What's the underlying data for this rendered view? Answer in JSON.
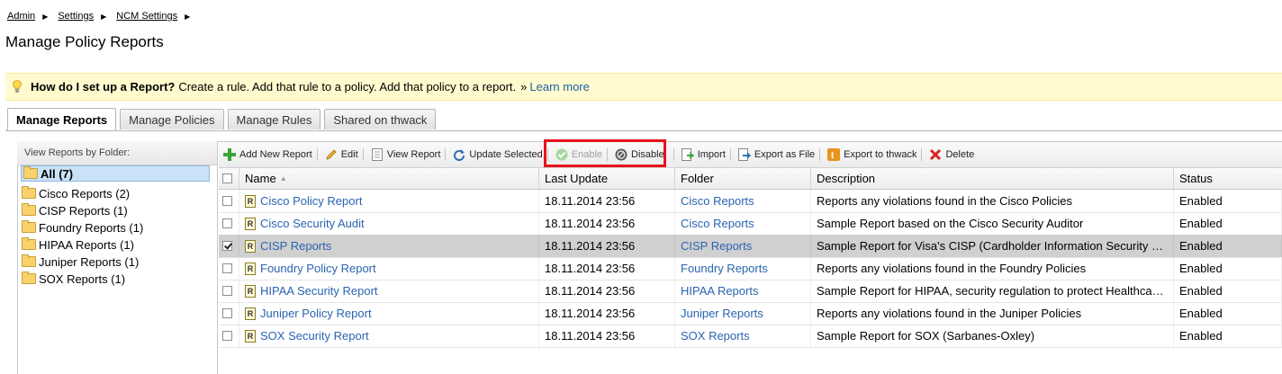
{
  "breadcrumb": [
    "Admin",
    "Settings",
    "NCM Settings"
  ],
  "page_title": "Manage Policy Reports",
  "hint": {
    "question": "How do I set up a Report?",
    "text": "Create a rule. Add that rule to a policy. Add that policy to a report.",
    "link_prefix": "»",
    "link": "Learn more"
  },
  "tabs": [
    "Manage Reports",
    "Manage Policies",
    "Manage Rules",
    "Shared on thwack"
  ],
  "folder_panel": {
    "header": "View Reports by Folder:",
    "items": [
      "All (7)",
      "Cisco Reports (2)",
      "CISP Reports (1)",
      "Foundry Reports (1)",
      "HIPAA Reports (1)",
      "Juniper Reports (1)",
      "SOX Reports (1)"
    ]
  },
  "toolbar": {
    "add": "Add New Report",
    "edit": "Edit",
    "view": "View Report",
    "update": "Update Selected",
    "enable": "Enable",
    "disable": "Disable",
    "import": "Import",
    "export_file": "Export as File",
    "export_thwack": "Export to thwack",
    "delete": "Delete"
  },
  "grid": {
    "columns": [
      "Name",
      "Last Update",
      "Folder",
      "Description",
      "Status"
    ],
    "sort_indicator": "▲",
    "rows": [
      {
        "name": "Cisco Policy Report",
        "date": "18.11.2014 23:56",
        "folder": "Cisco Reports",
        "desc": "Reports any violations found in the Cisco Policies",
        "status": "Enabled"
      },
      {
        "name": "Cisco Security Audit",
        "date": "18.11.2014 23:56",
        "folder": "Cisco Reports",
        "desc": "Sample Report based on the Cisco Security Auditor",
        "status": "Enabled"
      },
      {
        "name": "CISP Reports",
        "date": "18.11.2014 23:56",
        "folder": "CISP Reports",
        "desc": "Sample Report for Visa's CISP (Cardholder Information Security …",
        "status": "Enabled"
      },
      {
        "name": "Foundry Policy Report",
        "date": "18.11.2014 23:56",
        "folder": "Foundry Reports",
        "desc": "Reports any violations found in the Foundry Policies",
        "status": "Enabled"
      },
      {
        "name": "HIPAA Security Report",
        "date": "18.11.2014 23:56",
        "folder": "HIPAA Reports",
        "desc": "Sample Report for HIPAA, security regulation to protect Healthca…",
        "status": "Enabled"
      },
      {
        "name": "Juniper Policy Report",
        "date": "18.11.2014 23:56",
        "folder": "Juniper Reports",
        "desc": "Reports any violations found in the Juniper Policies",
        "status": "Enabled"
      },
      {
        "name": "SOX Security Report",
        "date": "18.11.2014 23:56",
        "folder": "SOX Reports",
        "desc": "Sample Report for SOX (Sarbanes-Oxley)",
        "status": "Enabled"
      }
    ]
  },
  "report_icon_glyph": "R",
  "colors": {
    "link": "#2a64b0",
    "hint_bg": "#fffbce",
    "highlight": "#e8121b",
    "selected_row": "#d0d0d0"
  }
}
